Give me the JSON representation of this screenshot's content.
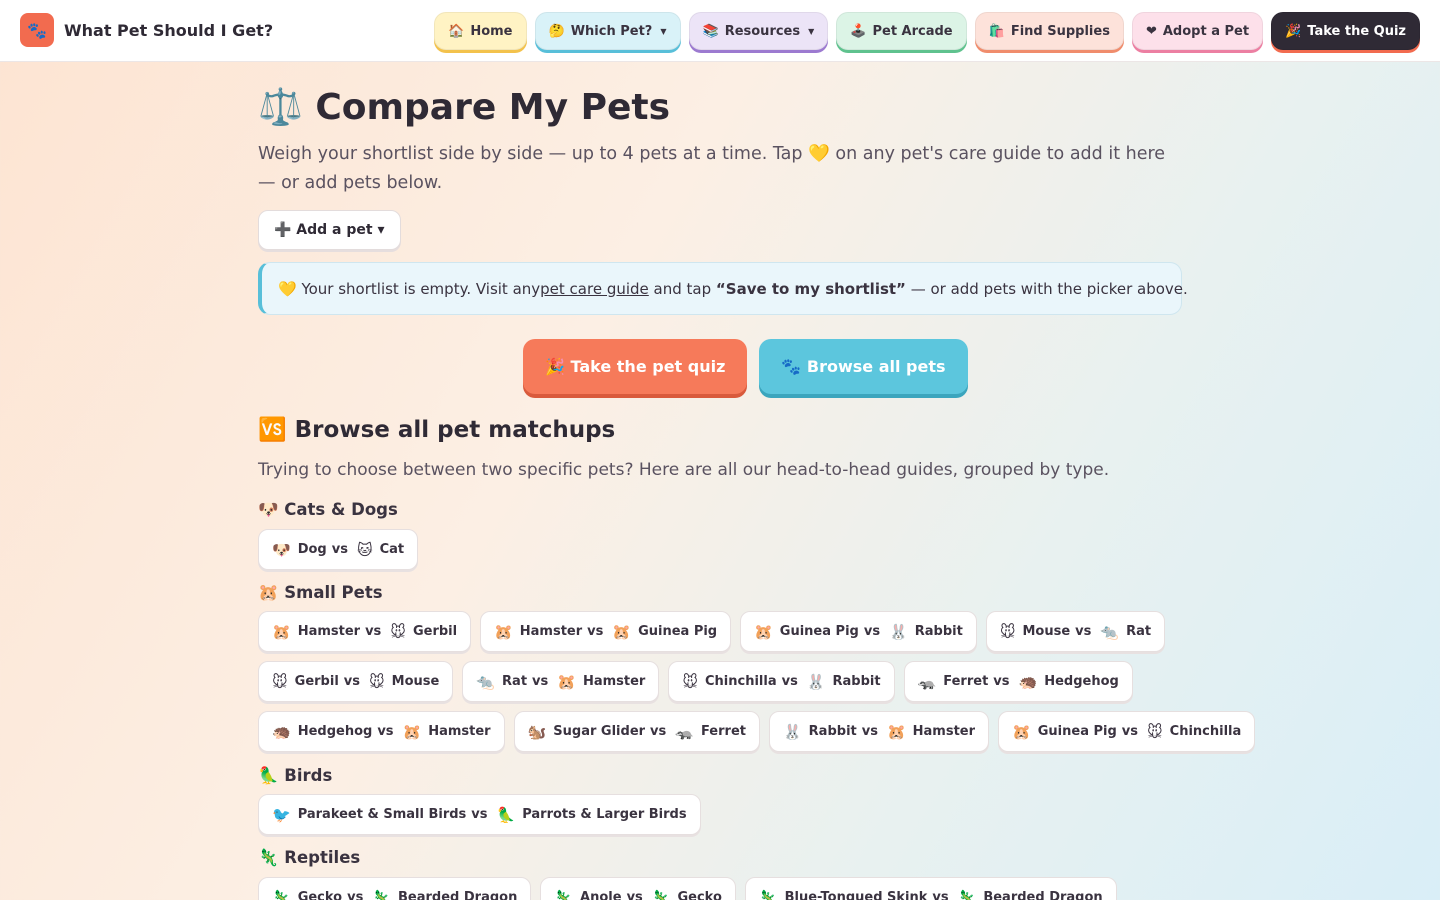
{
  "brand": {
    "logo_glyph": "🐾",
    "name": "What Pet Should I Get?"
  },
  "nav": [
    {
      "icon": "🏠",
      "label": "Home",
      "cls": "nb-home",
      "dropdown": false
    },
    {
      "icon": "🤔",
      "label": "Which Pet?",
      "cls": "nb-which",
      "dropdown": true
    },
    {
      "icon": "📚",
      "label": "Resources",
      "cls": "nb-res",
      "dropdown": true
    },
    {
      "icon": "🕹️",
      "label": "Pet Arcade",
      "cls": "nb-arcade",
      "dropdown": false
    },
    {
      "icon": "🛍️",
      "label": "Find Supplies",
      "cls": "nb-supplies",
      "dropdown": false
    },
    {
      "icon": "❤",
      "label": "Adopt a Pet",
      "cls": "nb-adopt",
      "dropdown": false
    },
    {
      "icon": "🎉",
      "label": "Take the Quiz",
      "cls": "nb-quiz",
      "dropdown": false
    }
  ],
  "page": {
    "title": "⚖️ Compare My Pets",
    "lead": "Weigh your shortlist side by side — up to 4 pets at a time. Tap 💛 on any pet's care guide to add it here — or add pets below.",
    "add_pet_label": "➕ Add a pet ▾"
  },
  "notice": {
    "prefix": "💛 Your shortlist is empty. Visit any ",
    "link": "pet care guide",
    "middle": " and tap ",
    "bold": "“Save to my shortlist”",
    "suffix": " — or add pets with the picker above."
  },
  "cta": {
    "quiz": "🎉 Take the pet quiz",
    "browse": "🐾 Browse all pets"
  },
  "matchups": {
    "title": "🆚 Browse all pet matchups",
    "lead": "Trying to choose between two specific pets? Here are all our head-to-head guides, grouped by type.",
    "groups": [
      {
        "title": "🐶 Cats & Dogs",
        "rows": [
          [
            {
              "a_icon": "🐶",
              "a": "Dog",
              "b_icon": "🐱",
              "b": "Cat"
            }
          ]
        ]
      },
      {
        "title": "🐹 Small Pets",
        "rows": [
          [
            {
              "a_icon": "🐹",
              "a": "Hamster",
              "b_icon": "🐭",
              "b": "Gerbil"
            },
            {
              "a_icon": "🐹",
              "a": "Hamster",
              "b_icon": "🐹",
              "b": "Guinea Pig"
            },
            {
              "a_icon": "🐹",
              "a": "Guinea Pig",
              "b_icon": "🐰",
              "b": "Rabbit"
            },
            {
              "a_icon": "🐭",
              "a": "Mouse",
              "b_icon": "🐀",
              "b": "Rat"
            }
          ],
          [
            {
              "a_icon": "🐭",
              "a": "Gerbil",
              "b_icon": "🐭",
              "b": "Mouse"
            },
            {
              "a_icon": "🐀",
              "a": "Rat",
              "b_icon": "🐹",
              "b": "Hamster"
            },
            {
              "a_icon": "🐭",
              "a": "Chinchilla",
              "b_icon": "🐰",
              "b": "Rabbit"
            },
            {
              "a_icon": "🦡",
              "a": "Ferret",
              "b_icon": "🦔",
              "b": "Hedgehog"
            }
          ],
          [
            {
              "a_icon": "🦔",
              "a": "Hedgehog",
              "b_icon": "🐹",
              "b": "Hamster"
            },
            {
              "a_icon": "🐿️",
              "a": "Sugar Glider",
              "b_icon": "🦡",
              "b": "Ferret"
            },
            {
              "a_icon": "🐰",
              "a": "Rabbit",
              "b_icon": "🐹",
              "b": "Hamster"
            },
            {
              "a_icon": "🐹",
              "a": "Guinea Pig",
              "b_icon": "🐭",
              "b": "Chinchilla"
            }
          ]
        ]
      },
      {
        "title": "🦜 Birds",
        "rows": [
          [
            {
              "a_icon": "🐦",
              "a": "Parakeet & Small Birds",
              "b_icon": "🦜",
              "b": "Parrots & Larger Birds"
            }
          ]
        ]
      },
      {
        "title": "🦎 Reptiles",
        "rows": [
          [
            {
              "a_icon": "🦎",
              "a": "Gecko",
              "b_icon": "🦎",
              "b": "Bearded Dragon"
            },
            {
              "a_icon": "🦎",
              "a": "Anole",
              "b_icon": "🦎",
              "b": "Gecko"
            },
            {
              "a_icon": "🦎",
              "a": "Blue-Tongued Skink",
              "b_icon": "🦎",
              "b": "Bearded Dragon"
            }
          ]
        ]
      }
    ]
  },
  "vs_word": "vs"
}
